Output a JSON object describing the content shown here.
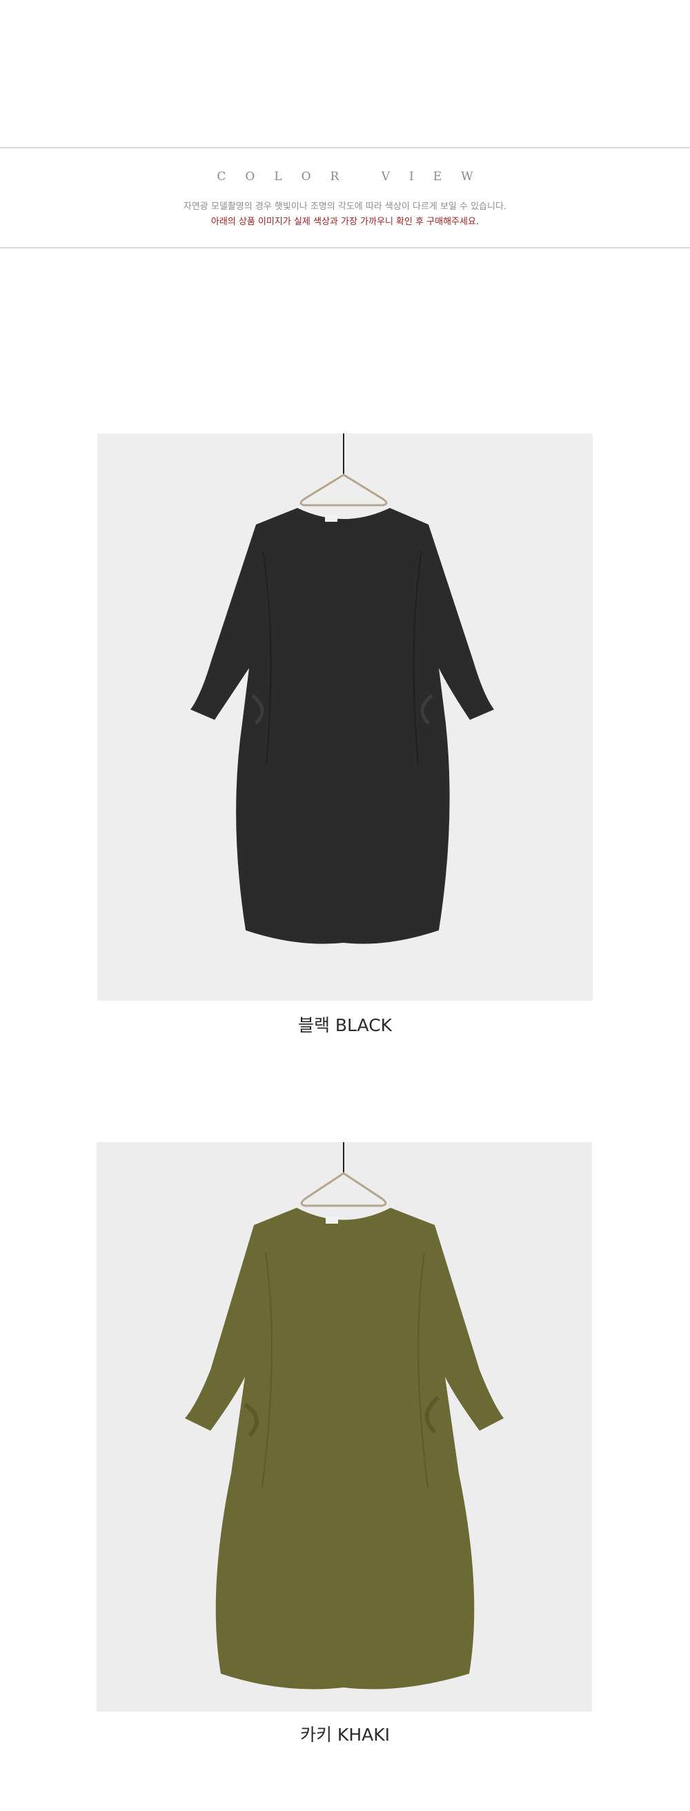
{
  "color_view": {
    "title": "COLOR VIEW",
    "note_line1": "자연광 모델촬영의 경우 햇빛이나 조명의 각도에 따라 색상이 다르게 보일 수 있습니다.",
    "note_line2": "아래의 상품 이미지가 실제 색상과 가장 가까우니 확인 후 구매해주세요.",
    "accent_color": "#9a1c1c"
  },
  "products": [
    {
      "caption": "블랙 BLACK",
      "garment_color": "#2b2b2b"
    },
    {
      "caption": "카키 KHAKI",
      "garment_color": "#6b6a34"
    }
  ]
}
